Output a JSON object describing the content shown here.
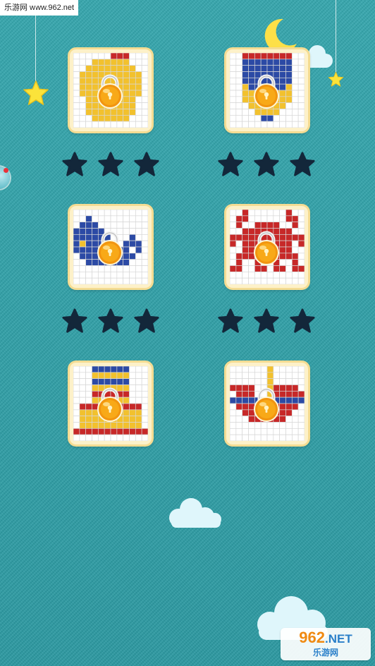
{
  "watermark": {
    "top_text": "乐游网 www.962.net",
    "logo_number": "962",
    "logo_suffix": ".NET",
    "logo_caption": "乐游网"
  },
  "colors": {
    "background": "#2f9fa6",
    "card_bg": "#fdf1c9",
    "card_border": "#f4dc93",
    "star_empty": "#13273a",
    "lock": "#f39a0c",
    "yellow": "#f2c12e",
    "blue": "#2c4aa5",
    "red": "#c72828",
    "moon": "#fde047"
  },
  "levels": [
    {
      "id": "level-1",
      "locked": true,
      "stars_earned": 0,
      "stars_total": 3,
      "palette": {
        "Y": "#f2c12e",
        "R": "#c72828",
        "B": "#2c4aa5"
      },
      "pixels": [
        "......RRR...",
        "...YYYYYY...",
        "..YYYYYYYY..",
        ".YYYYYYYYYY.",
        ".YYYYYYYYYY.",
        ".YYYYYYYYYY.",
        ".YYYYYYYYYY.",
        "..YYYYYYYY..",
        "..YYYYYYYY..",
        "..YYYYYYYY..",
        "...YYYYYY...",
        "............"
      ]
    },
    {
      "id": "level-2",
      "locked": true,
      "stars_earned": 0,
      "stars_total": 3,
      "palette": {
        "Y": "#f2c12e",
        "R": "#c72828",
        "B": "#2c4aa5"
      },
      "pixels": [
        "..RRRRRRRR..",
        "..BBBBBBBB..",
        "..BBBBBBBB..",
        "..BBBBBBBB..",
        "..BBBBBBBB..",
        "..YBBBBBBY..",
        "..YYYYYYYY..",
        "..YYYYYYYY..",
        "...YYYYYY...",
        "....YYYY....",
        ".....BB.....",
        "............"
      ]
    },
    {
      "id": "level-3",
      "locked": true,
      "stars_earned": 0,
      "stars_total": 3,
      "palette": {
        "Y": "#f2c12e",
        "R": "#c72828",
        "B": "#2c4aa5"
      },
      "pixels": [
        "............",
        "..B.........",
        ".BBB........",
        "BBBBB.......",
        "BBBBBB...B..",
        "BYBBBBB.BBB.",
        "BBBBBBBBB.B.",
        ".BBBBBBBBB..",
        "..BBBBBBB...",
        "............",
        "............",
        "............"
      ]
    },
    {
      "id": "level-4",
      "locked": true,
      "stars_earned": 0,
      "stars_total": 3,
      "palette": {
        "Y": "#f2c12e",
        "R": "#c72828",
        "B": "#2c4aa5"
      },
      "pixels": [
        "..R......R..",
        ".RR......RR.",
        ".R..RRRR..R.",
        "..RRRRRRRR..",
        "RRRRRRRRRRRR",
        "R.RRRRRRRR.R",
        "..RRRRRRRR..",
        ".RRRRRRRRRR.",
        ".R..R..R..R.",
        "RR..RR.RR.RR",
        "............",
        "............"
      ]
    },
    {
      "id": "level-5",
      "locked": true,
      "stars_earned": 0,
      "stars_total": 3,
      "palette": {
        "Y": "#f2c12e",
        "R": "#c72828",
        "B": "#2c4aa5"
      },
      "pixels": [
        "...BBBBBB...",
        "...YYYYYY...",
        "...BBBBBB...",
        "...YYYYYY...",
        "...RRRRRR...",
        "...YYYYYY...",
        ".RRRRRRRRRR.",
        ".YYYYYYYYYY.",
        ".YYYYYYYYYY.",
        ".YYYYYYYYYY.",
        "RRRRRRRRRRRR",
        "............"
      ]
    },
    {
      "id": "level-6",
      "locked": true,
      "stars_earned": 0,
      "stars_total": 3,
      "palette": {
        "Y": "#f2c12e",
        "R": "#c72828",
        "B": "#2c4aa5"
      },
      "pixels": [
        "......Y.....",
        "......Y.....",
        "......Y.....",
        "RRRR..YRRRR.",
        ".RRR..YRRRRR",
        "BBBBBBBBBBBB",
        ".RRRRRRRRRR.",
        "..RRRRRRRR..",
        "...RRRRRR...",
        "............",
        "............",
        "............"
      ]
    }
  ]
}
